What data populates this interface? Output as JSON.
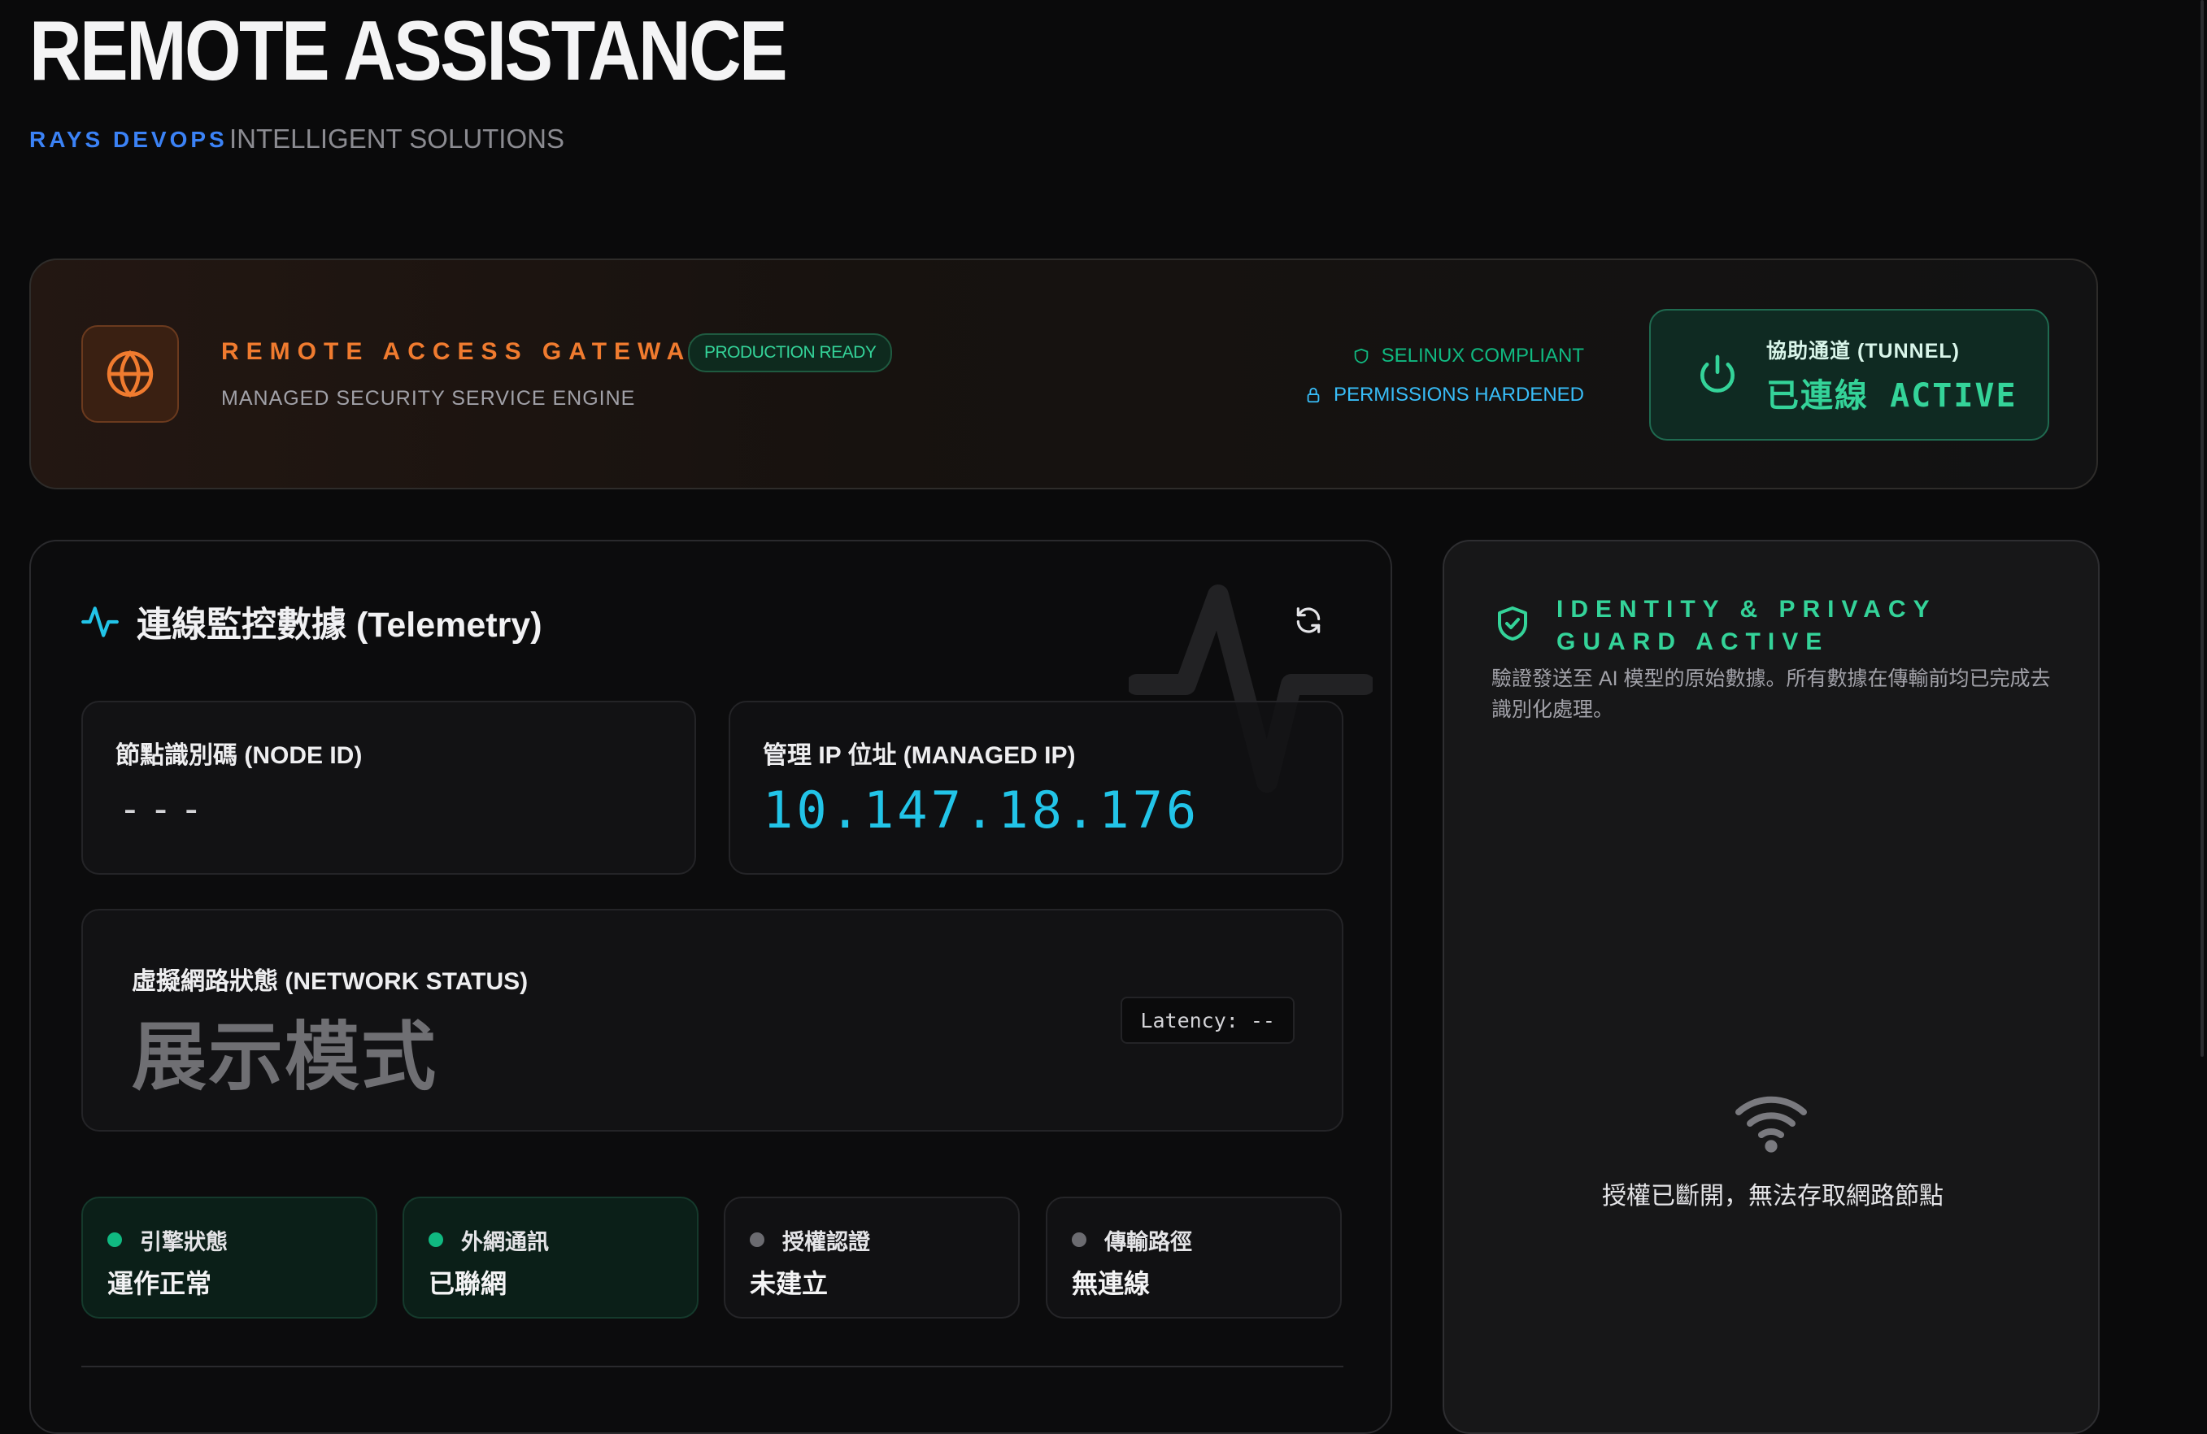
{
  "header": {
    "title": "REMOTE ASSISTANCE",
    "brand": "RAYS DEVOPS",
    "tagline": "INTELLIGENT SOLUTIONS"
  },
  "gateway": {
    "icon": "globe-icon",
    "title": "REMOTE ACCESS GATEWAY",
    "badge": "PRODUCTION READY",
    "subtitle": "MANAGED SECURITY SERVICE ENGINE",
    "compliance": [
      {
        "icon": "shield-icon",
        "label": "SELINUX COMPLIANT"
      },
      {
        "icon": "lock-icon",
        "label": "PERMISSIONS HARDENED"
      }
    ],
    "tunnel": {
      "icon": "power-icon",
      "label": "協助通道 (TUNNEL)",
      "status": "已連線 ACTIVE"
    }
  },
  "telemetry": {
    "icon": "activity-icon",
    "title": "連線監控數據 (Telemetry)",
    "refresh_icon": "refresh-icon",
    "node_id": {
      "label": "節點識別碼 (NODE ID)",
      "value": "---"
    },
    "managed_ip": {
      "label": "管理 IP 位址 (MANAGED IP)",
      "value": "10.147.18.176"
    },
    "network": {
      "label": "虛擬網路狀態 (NETWORK STATUS)",
      "value": "展示模式",
      "latency": "Latency: --"
    },
    "statuses": [
      {
        "label": "引擎狀態",
        "value": "運作正常",
        "active": true
      },
      {
        "label": "外網通訊",
        "value": "已聯網",
        "active": true
      },
      {
        "label": "授權認證",
        "value": "未建立",
        "active": false
      },
      {
        "label": "傳輸路徑",
        "value": "無連線",
        "active": false
      }
    ]
  },
  "privacy": {
    "icon": "shield-check-icon",
    "title": "IDENTITY & PRIVACY GUARD ACTIVE",
    "description": "驗證發送至 AI 模型的原始數據。所有數據在傳輸前均已完成去識別化處理。",
    "empty_icon": "wifi-icon",
    "empty_message": "授權已斷開，無法存取網路節點"
  },
  "colors": {
    "accent_orange": "#f07b2f",
    "accent_green": "#34d399",
    "accent_cyan": "#22c4e8",
    "accent_blue": "#3b82f6"
  }
}
